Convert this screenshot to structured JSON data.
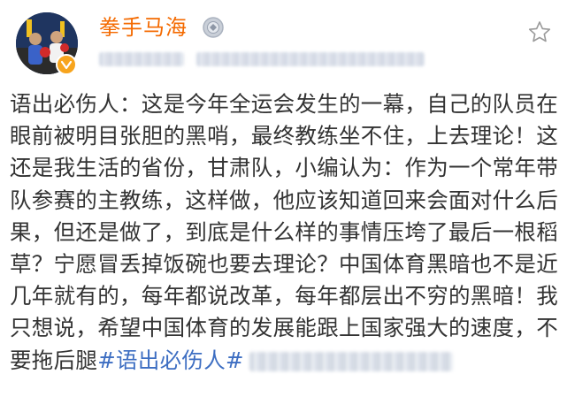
{
  "post": {
    "author": {
      "name": "拳手马海",
      "avatar": "avatar-boxing",
      "verified": true,
      "medal": "medal-icon"
    },
    "favorite_icon": "star-outline-icon",
    "body": {
      "text": "语出必伤人：这是今年全运会发生的一幕，自己的队员在眼前被明目张胆的黑哨，最终教练坐不住，上去理论！这还是我生活的省份，甘肃队，小编认为：作为一个常年带队参赛的主教练，这样做，他应该知道回来会面对什么后果，但还是做了，到底是什么样的事情压垮了最后一根稻草？宁愿冒丢掉饭碗也要去理论？中国体育黑暗也不是近几年就有的，每年都说改革，每年都层出不穷的黑暗！我只想说，希望中国体育的发展能跟上国家强大的速度，不要拖后腿",
      "hashtag": "#语出必伤人#"
    }
  },
  "colors": {
    "username": "#f46a00",
    "text": "#333333",
    "hashtag": "#3d6ec2",
    "verified_badge": "#f7a41d"
  }
}
